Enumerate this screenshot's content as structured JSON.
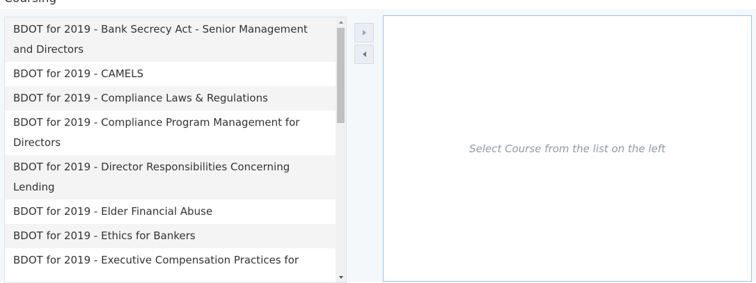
{
  "header": {
    "label": "Coursing"
  },
  "course_list": {
    "items": [
      {
        "label": "BDOT for 2019 - Bank Secrecy Act - Senior Management and Directors"
      },
      {
        "label": "BDOT for 2019 - CAMELS"
      },
      {
        "label": "BDOT for 2019 - Compliance Laws & Regulations"
      },
      {
        "label": "BDOT for 2019 - Compliance Program Management for Directors"
      },
      {
        "label": "BDOT for 2019 - Director Responsibilities Concerning Lending"
      },
      {
        "label": "BDOT for 2019 - Elder Financial Abuse"
      },
      {
        "label": "BDOT for 2019 - Ethics for Bankers"
      },
      {
        "label": "BDOT for 2019 - Executive Compensation Practices for"
      }
    ]
  },
  "move_buttons": {
    "add_icon": "chevron-right-icon",
    "remove_icon": "chevron-left-icon"
  },
  "detail_panel": {
    "placeholder": "Select Course from the list on the left"
  },
  "colors": {
    "panel_bg": "#f4f8fb",
    "detail_border": "#9cc3e0",
    "placeholder_text": "#8e9aa5"
  }
}
